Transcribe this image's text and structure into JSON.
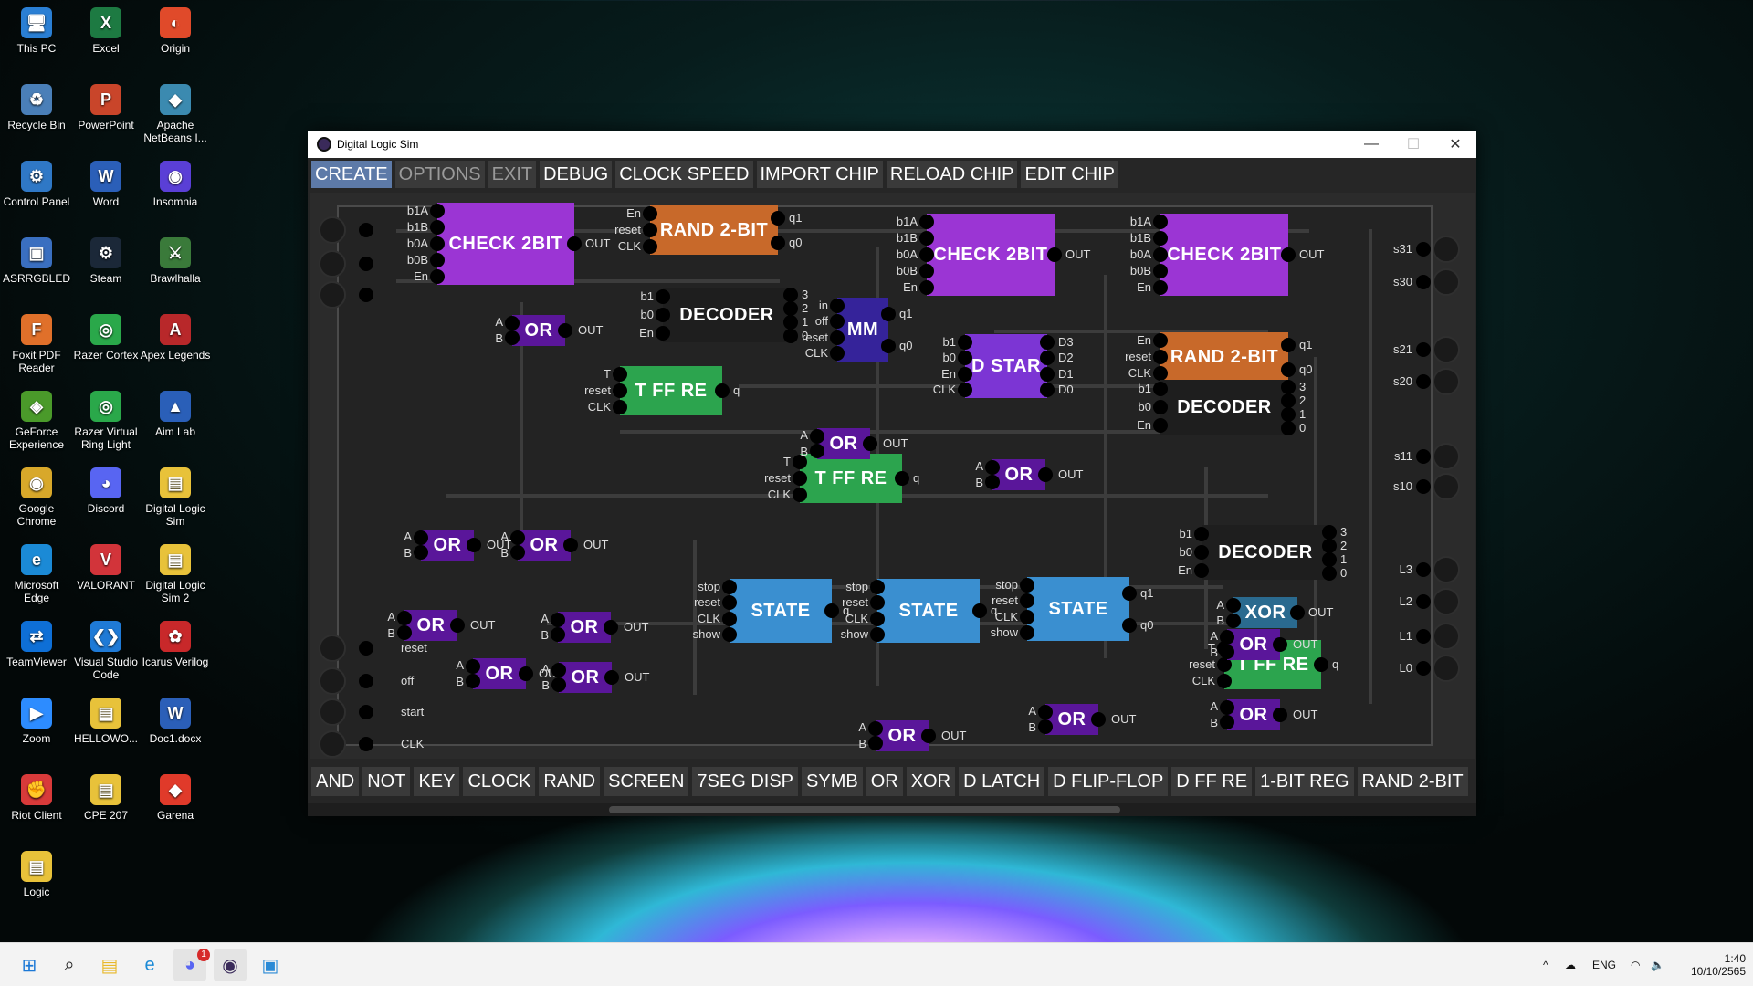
{
  "desktop_icons": [
    {
      "label": "This PC",
      "glyph": "🖥",
      "color": "#2a7fd4"
    },
    {
      "label": "Excel",
      "glyph": "X",
      "color": "#1d7a42"
    },
    {
      "label": "Origin",
      "glyph": "◐",
      "color": "#e04a2a"
    },
    {
      "label": "Recycle Bin",
      "glyph": "♻",
      "color": "#4a7fb8"
    },
    {
      "label": "PowerPoint",
      "glyph": "P",
      "color": "#c9452a"
    },
    {
      "label": "Apache NetBeans I...",
      "glyph": "◆",
      "color": "#3b8ab0"
    },
    {
      "label": "Control Panel",
      "glyph": "⚙",
      "color": "#2f78c6"
    },
    {
      "label": "Word",
      "glyph": "W",
      "color": "#2b5fb8"
    },
    {
      "label": "Insomnia",
      "glyph": "◉",
      "color": "#5a3fd6"
    },
    {
      "label": "ASRRGBLED",
      "glyph": "▣",
      "color": "#3a6fc0"
    },
    {
      "label": "Steam",
      "glyph": "⚙",
      "color": "#1b2838"
    },
    {
      "label": "Brawlhalla",
      "glyph": "⚔",
      "color": "#3a7a3a"
    },
    {
      "label": "Foxit PDF Reader",
      "glyph": "F",
      "color": "#e0702a"
    },
    {
      "label": "Razer Cortex",
      "glyph": "◎",
      "color": "#2aa84a"
    },
    {
      "label": "Apex Legends",
      "glyph": "A",
      "color": "#b8282a"
    },
    {
      "label": "GeForce Experience",
      "glyph": "◈",
      "color": "#4a9a2a"
    },
    {
      "label": "Razer Virtual Ring Light",
      "glyph": "◎",
      "color": "#2aa84a"
    },
    {
      "label": "Aim Lab",
      "glyph": "▲",
      "color": "#2a5fb8"
    },
    {
      "label": "Google Chrome",
      "glyph": "◉",
      "color": "#d8a82a"
    },
    {
      "label": "Discord",
      "glyph": "◕",
      "color": "#5865f2"
    },
    {
      "label": "Digital Logic Sim",
      "glyph": "▤",
      "color": "#e8c23a"
    },
    {
      "label": "Microsoft Edge",
      "glyph": "e",
      "color": "#1b8ad6"
    },
    {
      "label": "VALORANT",
      "glyph": "V",
      "color": "#d2343a"
    },
    {
      "label": "Digital Logic Sim 2",
      "glyph": "▤",
      "color": "#e8c23a"
    },
    {
      "label": "TeamViewer",
      "glyph": "⇄",
      "color": "#0e6fd6"
    },
    {
      "label": "Visual Studio Code",
      "glyph": "❮❯",
      "color": "#1f7ad6"
    },
    {
      "label": "Icarus Verilog",
      "glyph": "✿",
      "color": "#c8282a"
    },
    {
      "label": "Zoom",
      "glyph": "▶",
      "color": "#2d8cff"
    },
    {
      "label": "HELLOWO...",
      "glyph": "▤",
      "color": "#e8c23a"
    },
    {
      "label": "Doc1.docx",
      "glyph": "W",
      "color": "#2b5fb8"
    },
    {
      "label": "Riot Client",
      "glyph": "✊",
      "color": "#d83a3a"
    },
    {
      "label": "CPE 207",
      "glyph": "▤",
      "color": "#e8c23a"
    },
    {
      "label": "Garena",
      "glyph": "◆",
      "color": "#e03a2a"
    },
    {
      "label": "Logic",
      "glyph": "▤",
      "color": "#e8c23a"
    }
  ],
  "window": {
    "title": "Digital Logic Sim",
    "minimize": "—",
    "maximize": "☐",
    "close": "✕"
  },
  "menu": [
    {
      "label": "CREATE",
      "state": "active"
    },
    {
      "label": "OPTIONS",
      "state": "dim"
    },
    {
      "label": "EXIT",
      "state": "dim"
    },
    {
      "label": "DEBUG",
      "state": ""
    },
    {
      "label": "CLOCK SPEED",
      "state": ""
    },
    {
      "label": "IMPORT CHIP",
      "state": ""
    },
    {
      "label": "RELOAD CHIP",
      "state": ""
    },
    {
      "label": "EDIT CHIP",
      "state": ""
    }
  ],
  "chip_colors": {
    "check": "#9b35d4",
    "rand": "#c8692a",
    "decoder": "#1e1e1e",
    "or": "#5a169a",
    "mm": "#35239a",
    "dstar": "#7c35d4",
    "tff": "#2ca44e",
    "state": "#3a8fd0",
    "xor": "#2a6a8f"
  },
  "chips": [
    {
      "id": "check1",
      "label": "CHECK 2BIT",
      "kind": "check",
      "pins_left": [
        "b1A",
        "b1B",
        "b0A",
        "b0B",
        "En"
      ],
      "pins_right": [
        "OUT"
      ]
    },
    {
      "id": "rand1",
      "label": "RAND 2-BIT",
      "kind": "rand",
      "pins_left": [
        "En",
        "reset",
        "CLK"
      ],
      "pins_right": [
        "q1",
        "q0"
      ]
    },
    {
      "id": "check2",
      "label": "CHECK 2BIT",
      "kind": "check",
      "pins_left": [
        "b1A",
        "b1B",
        "b0A",
        "b0B",
        "En"
      ],
      "pins_right": [
        "OUT"
      ]
    },
    {
      "id": "check3",
      "label": "CHECK 2BIT",
      "kind": "check",
      "pins_left": [
        "b1A",
        "b1B",
        "b0A",
        "b0B",
        "En"
      ],
      "pins_right": [
        "OUT"
      ]
    },
    {
      "id": "dec1",
      "label": "DECODER",
      "kind": "decoder",
      "pins_left": [
        "b1",
        "b0",
        "En"
      ],
      "pins_right": [
        "3",
        "2",
        "1",
        "0"
      ]
    },
    {
      "id": "mm",
      "label": "MM",
      "kind": "mm",
      "pins_left": [
        "in",
        "off",
        "reset",
        "CLK"
      ],
      "pins_right": [
        "q1",
        "q0"
      ]
    },
    {
      "id": "dstar",
      "label": "D STAR",
      "kind": "dstar",
      "pins_left": [
        "b1",
        "b0",
        "En",
        "CLK"
      ],
      "pins_right": [
        "D3",
        "D2",
        "D1",
        "D0"
      ]
    },
    {
      "id": "rand2",
      "label": "RAND 2-BIT",
      "kind": "rand",
      "pins_left": [
        "En",
        "reset",
        "CLK"
      ],
      "pins_right": [
        "q1",
        "q0"
      ]
    },
    {
      "id": "tff1",
      "label": "T FF RE",
      "kind": "tff",
      "pins_left": [
        "T",
        "reset",
        "CLK"
      ],
      "pins_right": [
        "q"
      ]
    },
    {
      "id": "dec2",
      "label": "DECODER",
      "kind": "decoder",
      "pins_left": [
        "b1",
        "b0",
        "En"
      ],
      "pins_right": [
        "3",
        "2",
        "1",
        "0"
      ]
    },
    {
      "id": "tff2",
      "label": "T FF RE",
      "kind": "tff",
      "pins_left": [
        "T",
        "reset",
        "CLK"
      ],
      "pins_right": [
        "q"
      ]
    },
    {
      "id": "dec3",
      "label": "DECODER",
      "kind": "decoder",
      "pins_left": [
        "b1",
        "b0",
        "En"
      ],
      "pins_right": [
        "3",
        "2",
        "1",
        "0"
      ]
    },
    {
      "id": "state1",
      "label": "STATE",
      "kind": "state",
      "pins_left": [
        "stop",
        "reset",
        "CLK",
        "show"
      ],
      "pins_right": [
        "q"
      ]
    },
    {
      "id": "state2",
      "label": "STATE",
      "kind": "state",
      "pins_left": [
        "stop",
        "reset",
        "CLK",
        "show"
      ],
      "pins_right": [
        "q"
      ]
    },
    {
      "id": "state3",
      "label": "STATE",
      "kind": "state",
      "pins_left": [
        "stop",
        "reset",
        "CLK",
        "show"
      ],
      "pins_right": [
        "q1",
        "q0"
      ]
    },
    {
      "id": "xor",
      "label": "XOR",
      "kind": "xor",
      "pins_left": [
        "A",
        "B"
      ],
      "pins_right": [
        "OUT"
      ]
    },
    {
      "id": "tff3",
      "label": "T FF RE",
      "kind": "tff",
      "pins_left": [
        "T",
        "reset",
        "CLK"
      ],
      "pins_right": [
        "q"
      ]
    }
  ],
  "or_gate": {
    "label": "OR",
    "in_a": "A",
    "in_b": "B",
    "out": "OUT"
  },
  "left_inputs": [
    "reset",
    "off",
    "start",
    "CLK"
  ],
  "right_outputs": [
    "s31",
    "s30",
    "s21",
    "s20",
    "s11",
    "s10",
    "L3",
    "L2",
    "L1",
    "L0"
  ],
  "palette": [
    "AND",
    "NOT",
    "KEY",
    "CLOCK",
    "RAND",
    "SCREEN",
    "7SEG DISP",
    "SYMB",
    "OR",
    "XOR",
    "D LATCH",
    "D FLIP-FLOP",
    "D FF RE",
    "1-BIT REG",
    "RAND 2-BIT"
  ],
  "taskbar": {
    "apps": [
      {
        "name": "start-icon",
        "glyph": "⊞",
        "color": "#1b78d6"
      },
      {
        "name": "search-icon",
        "glyph": "⌕",
        "color": "#222"
      },
      {
        "name": "file-explorer-icon",
        "glyph": "▤",
        "color": "#e8b82a"
      },
      {
        "name": "edge-icon",
        "glyph": "e",
        "color": "#1b8ad6"
      },
      {
        "name": "discord-icon",
        "glyph": "◕",
        "color": "#5865f2"
      },
      {
        "name": "digital-logic-sim-icon",
        "glyph": "◉",
        "color": "#3a2a5a"
      },
      {
        "name": "photos-icon",
        "glyph": "▣",
        "color": "#2a8ad6"
      }
    ],
    "discord_badge": "1",
    "lang": "ENG",
    "time": "1:40",
    "date": "10/10/2565"
  }
}
